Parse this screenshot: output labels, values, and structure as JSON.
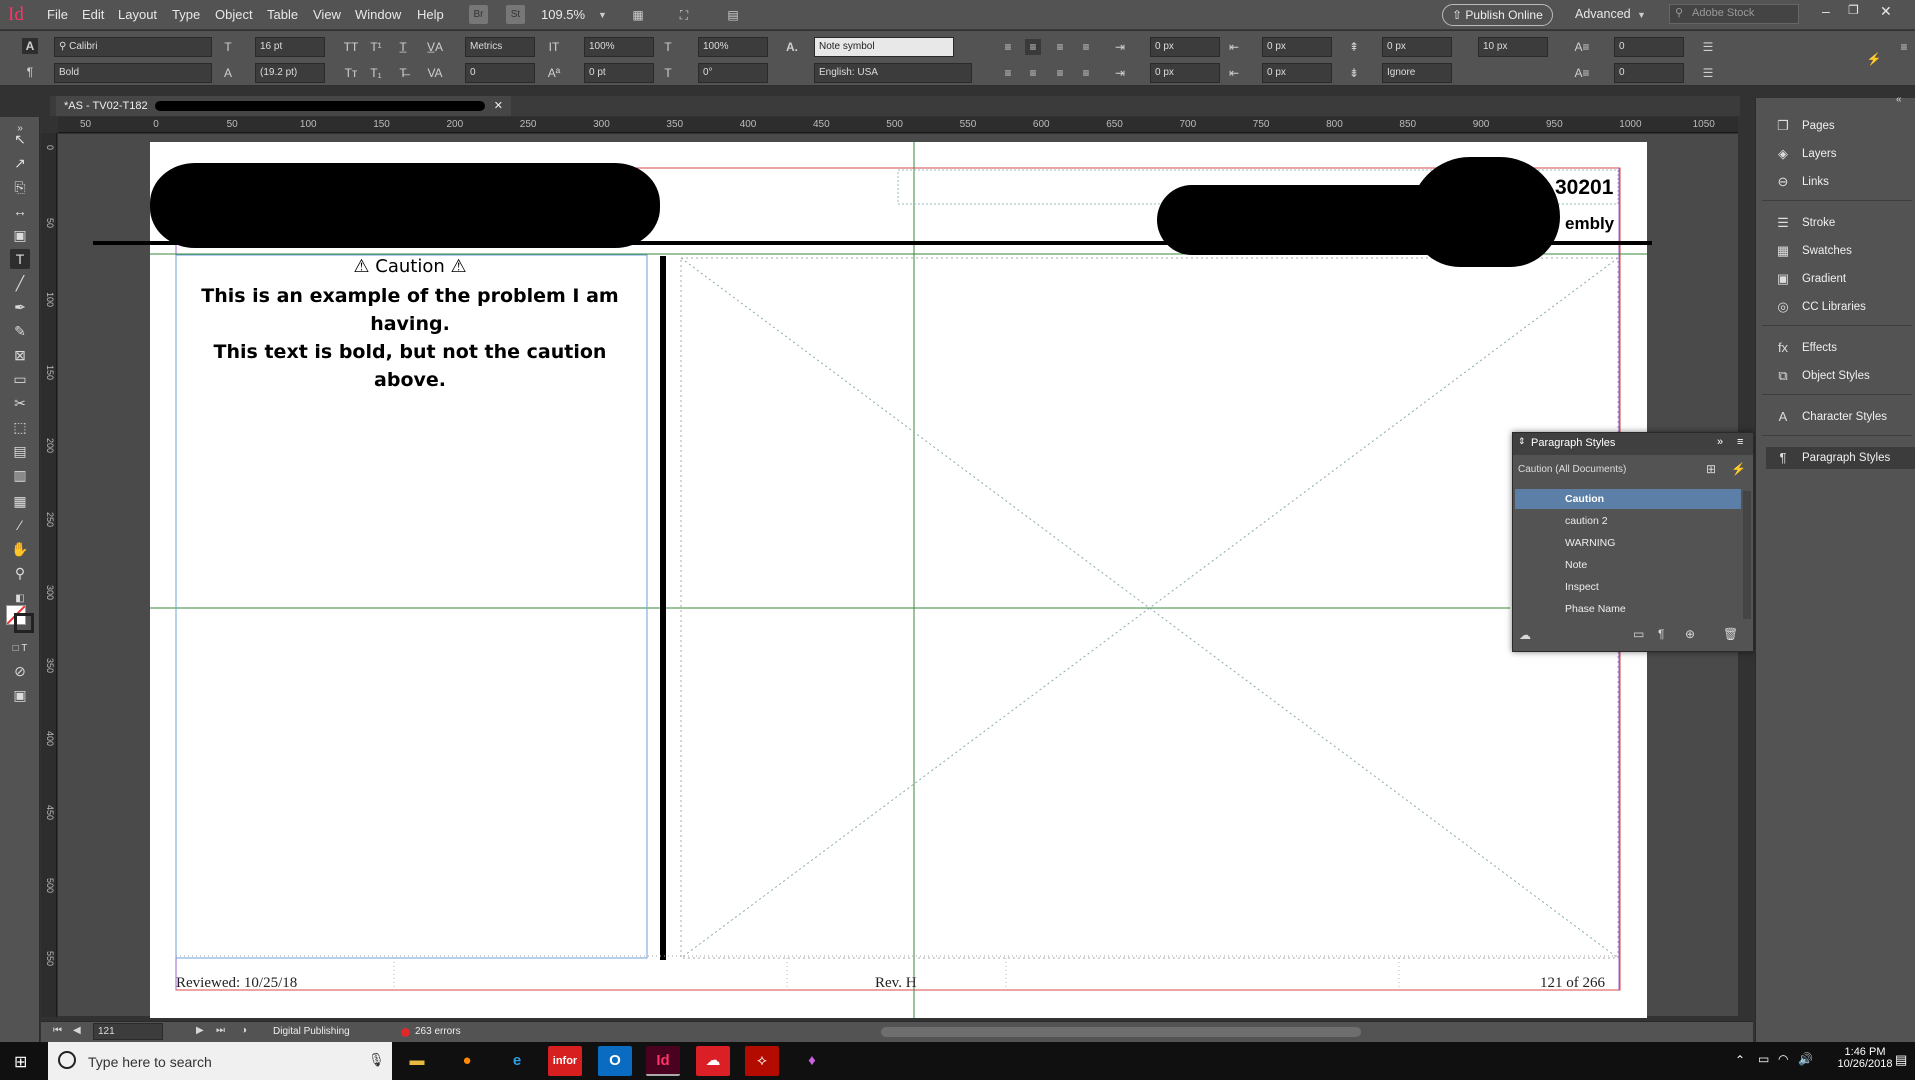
{
  "app": {
    "icon_text": "Id"
  },
  "menu": [
    "File",
    "Edit",
    "Layout",
    "Type",
    "Object",
    "Table",
    "View",
    "Window",
    "Help"
  ],
  "topbar": {
    "bridge_label": "Br",
    "stock_label": "St",
    "zoom": "109.5%",
    "publish_label": "Publish Online",
    "workspace_label": "Advanced",
    "search_placeholder": "Adobe Stock"
  },
  "control": {
    "font_family": "Calibri",
    "font_style": "Bold",
    "font_size": "16 pt",
    "leading": "(19.2 pt)",
    "kerning": "Metrics",
    "tracking": "0",
    "vscale": "100%",
    "hscale": "100%",
    "baseline": "0 pt",
    "skew": "0°",
    "char_style": "Note symbol",
    "language": "English: USA",
    "left_indent": "0 px",
    "right_indent": "0 px",
    "first_indent": "0 px",
    "last_indent": "0 px",
    "space_before": "0 px",
    "space_after": "0 px",
    "drop_cap_lines": "0",
    "drop_cap_chars": "0",
    "tracking_px": "10 px",
    "grid_mode": "Ignore"
  },
  "doc_tab": {
    "label": "*AS - TV02-T182"
  },
  "ruler_h": [
    "50",
    "0",
    "50",
    "100",
    "150",
    "200",
    "250",
    "300",
    "350",
    "400",
    "450",
    "500",
    "550",
    "600",
    "650",
    "700",
    "750",
    "800",
    "850",
    "900",
    "950",
    "1000",
    "1050"
  ],
  "ruler_v": [
    "0",
    "50",
    "100",
    "150",
    "200",
    "250",
    "300",
    "350",
    "400",
    "450",
    "500",
    "550"
  ],
  "page": {
    "header_number": "30201",
    "header_sub": "embly",
    "caution_title": "⚠ Caution ⚠",
    "body_line1": "This is an example of the problem I am having.",
    "body_line2": "This text is bold, but not the caution above.",
    "footer_reviewed": "Reviewed: 10/25/18",
    "footer_rev": "Rev. H",
    "footer_page": "121 of 266"
  },
  "right_panel": [
    {
      "label": "Pages",
      "icon": "pages-icon"
    },
    {
      "label": "Layers",
      "icon": "layers-icon"
    },
    {
      "label": "Links",
      "icon": "links-icon"
    },
    {
      "label": "Stroke",
      "icon": "stroke-icon"
    },
    {
      "label": "Swatches",
      "icon": "swatches-icon"
    },
    {
      "label": "Gradient",
      "icon": "gradient-icon"
    },
    {
      "label": "CC Libraries",
      "icon": "cc-libraries-icon"
    },
    {
      "label": "Effects",
      "icon": "effects-icon"
    },
    {
      "label": "Object Styles",
      "icon": "object-styles-icon"
    },
    {
      "label": "Character Styles",
      "icon": "character-styles-icon"
    },
    {
      "label": "Paragraph Styles",
      "icon": "paragraph-styles-icon"
    }
  ],
  "paragraph_styles": {
    "title": "Paragraph Styles",
    "current": "Caution (All Documents)",
    "items": [
      "Caution",
      "caution 2",
      "WARNING",
      "Note",
      "Inspect",
      "Phase Name"
    ],
    "selected": "Caution"
  },
  "status": {
    "page_number": "121",
    "preflight_profile": "Digital Publishing",
    "errors": "263 errors"
  },
  "taskbar": {
    "search_placeholder": "Type here to search",
    "time": "1:46 PM",
    "date": "10/26/2018",
    "apps": [
      "file-explorer",
      "firefox",
      "internet-explorer",
      "infor",
      "outlook",
      "indesign",
      "creative-cloud",
      "acrobat",
      "maps"
    ]
  },
  "colors": {
    "accent": "#5b7fa7",
    "indesign": "#ff3366",
    "margin_red": "#d94a4a",
    "guide_green": "#3a8a3a"
  }
}
